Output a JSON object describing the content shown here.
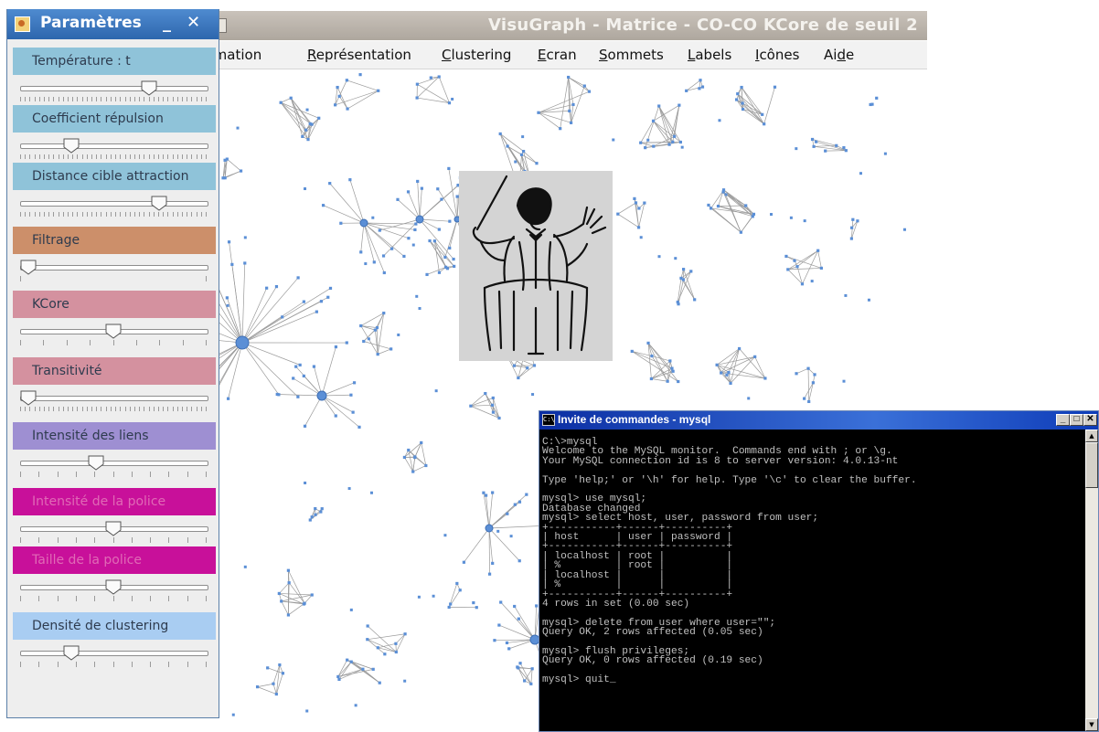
{
  "main_window": {
    "title": "VisuGraph - Matrice - CO-CO KCore de seuil 2",
    "menu": [
      {
        "label": "Animation",
        "mnemonic_index": -1
      },
      {
        "label": "Représentation",
        "mnemonic_index": 0
      },
      {
        "label": "Clustering",
        "mnemonic_index": 0
      },
      {
        "label": "Ecran",
        "mnemonic_index": 0
      },
      {
        "label": "Sommets",
        "mnemonic_index": 0
      },
      {
        "label": "Labels",
        "mnemonic_index": 0
      },
      {
        "label": "Icônes",
        "mnemonic_index": 0
      },
      {
        "label": "Aide",
        "mnemonic_index": 2
      }
    ],
    "menu_visible_first": "nimation"
  },
  "params_panel": {
    "title": "Paramètres",
    "minimize_glyph": "_",
    "close_glyph": "✕",
    "sliders": [
      {
        "label": "Température : t",
        "color": "#8fc3d9",
        "text_color": "#2e3b4e",
        "value": 0.71,
        "tick_style": "dense"
      },
      {
        "label": "Coefficient répulsion",
        "color": "#8fc3d9",
        "text_color": "#2e3b4e",
        "value": 0.25,
        "tick_style": "dense"
      },
      {
        "label": "Distance cible attraction",
        "color": "#8fc3d9",
        "text_color": "#2e3b4e",
        "value": 0.77,
        "tick_style": "dense"
      },
      {
        "label": "Filtrage",
        "color": "#cc8f6a",
        "text_color": "#2e3b4e",
        "value": 0.0,
        "tick_style": "ends"
      },
      {
        "label": "KCore",
        "color": "#d4919f",
        "text_color": "#2e3b4e",
        "value": 0.5,
        "tick_style": "medium"
      },
      {
        "label": "Transitivité",
        "color": "#d4919f",
        "text_color": "#2e3b4e",
        "value": 0.0,
        "tick_style": "dense"
      },
      {
        "label": "Intensité des liens",
        "color": "#9e8fd2",
        "text_color": "#2e3b4e",
        "value": 0.4,
        "tick_style": "sparse"
      },
      {
        "label": "Intensité de la police",
        "color": "#c8109a",
        "text_color": "#e06ab6",
        "value": 0.5,
        "tick_style": "sparse"
      },
      {
        "label": "Taille de la police",
        "color": "#c8109a",
        "text_color": "#e06ab6",
        "value": 0.5,
        "tick_style": "sparse"
      },
      {
        "label": "Densité de clustering",
        "color": "#a9cdf2",
        "text_color": "#2e3b4e",
        "value": 0.25,
        "tick_style": "sparse"
      }
    ]
  },
  "cmd_window": {
    "title": "Invite de commandes - mysql",
    "icon_text": "C:\\",
    "buttons": [
      "_",
      "□",
      "✕"
    ],
    "lines": [
      "C:\\>mysql",
      "Welcome to the MySQL monitor.  Commands end with ; or \\g.",
      "Your MySQL connection id is 8 to server version: 4.0.13-nt",
      "",
      "Type 'help;' or '\\h' for help. Type '\\c' to clear the buffer.",
      "",
      "mysql> use mysql;",
      "Database changed",
      "mysql> select host, user, password from user;",
      "+-----------+------+----------+",
      "| host      | user | password |",
      "+-----------+------+----------+",
      "| localhost | root |          |",
      "| %         | root |          |",
      "| localhost |      |          |",
      "| %         |      |          |",
      "+-----------+------+----------+",
      "4 rows in set (0.00 sec)",
      "",
      "mysql> delete from user where user=\"\";",
      "Query OK, 2 rows affected (0.05 sec)",
      "",
      "mysql> flush privileges;",
      "Query OK, 0 rows affected (0.19 sec)",
      "",
      "mysql> quit_"
    ]
  },
  "colors": {
    "node": "#5b8fd6",
    "edge": "#9a9a9a",
    "panel_title": "#2d66ad",
    "cmd_title": "#0b2ea3"
  }
}
